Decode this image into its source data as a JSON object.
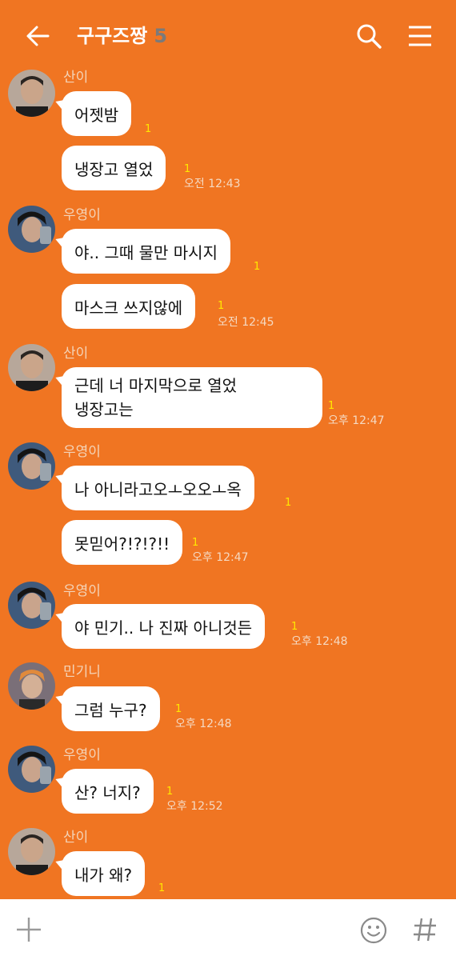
{
  "header": {
    "title": "구구즈짱",
    "member_count": "5",
    "back_icon": "arrow-left-icon",
    "search_icon": "search-icon",
    "menu_icon": "hamburger-menu-icon"
  },
  "messages": [
    {
      "sender": "산이",
      "text": "어젯밤",
      "unread": "1",
      "time": ""
    },
    {
      "sender": "산이",
      "text": "냉장고 열었",
      "unread": "1",
      "time": "오전 12:43"
    },
    {
      "sender": "우영이",
      "text": "야.. 그때 물만 마시지",
      "unread": "1",
      "time": ""
    },
    {
      "sender": "우영이",
      "text": "마스크 쓰지않에",
      "unread": "1",
      "time": "오전 12:45"
    },
    {
      "sender": "산이",
      "text_line1": "근데 너 마지막으로 열었",
      "text_line2": "냉장고는",
      "unread": "1",
      "time": "오후 12:47"
    },
    {
      "sender": "우영이",
      "text": "나 아니라고오ㅗ오오ㅗ옥",
      "unread": "1",
      "time": ""
    },
    {
      "sender": "우영이",
      "text": "못믿어?!?!?!!",
      "unread": "1",
      "time": "오후 12:47"
    },
    {
      "sender": "우영이",
      "text": "야 민기.. 나 진짜 아니것든",
      "unread": "1",
      "time": "오후 12:48"
    },
    {
      "sender": "민기니",
      "text": "그럼 누구?",
      "unread": "1",
      "time": "오후 12:48"
    },
    {
      "sender": "우영이",
      "text": "산? 너지?",
      "unread": "1",
      "time": "오후 12:52"
    },
    {
      "sender": "산이",
      "text": "내가 왜?",
      "unread": "1",
      "time": ""
    }
  ],
  "input_bar": {
    "plus_icon": "plus-icon",
    "emoji_icon": "emoji-icon",
    "hash_icon": "hash-icon"
  },
  "colors": {
    "background": "#F07522",
    "bubble": "#FFFFFF",
    "unread": "#FFE800",
    "member_count": "#7A7A7A"
  }
}
